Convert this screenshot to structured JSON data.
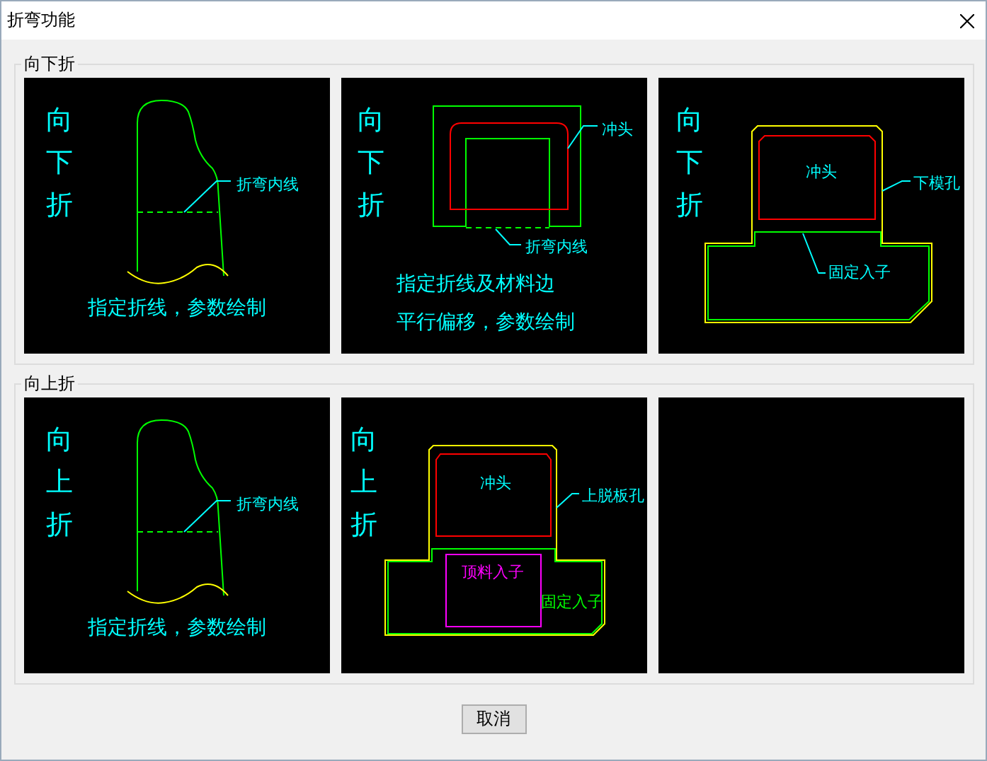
{
  "window": {
    "title": "折弯功能"
  },
  "groups": [
    {
      "title": "向下折",
      "panels": [
        {
          "kind": "profile",
          "side_label": "向下折",
          "labels": [
            {
              "text": "折弯内线",
              "color": "#00ffff"
            }
          ],
          "caption": [
            "指定折线，参数绘制"
          ]
        },
        {
          "kind": "punch",
          "side_label": "向下折",
          "labels": [
            {
              "text": "冲头",
              "color": "#00ffff"
            },
            {
              "text": "折弯内线",
              "color": "#00ffff"
            }
          ],
          "caption": [
            "指定折线及材料边",
            "平行偏移，参数绘制"
          ]
        },
        {
          "kind": "die",
          "side_label": "向下折",
          "labels": [
            {
              "text": "冲头",
              "color": "#00ffff"
            },
            {
              "text": "下模孔",
              "color": "#00ffff"
            },
            {
              "text": "固定入子",
              "color": "#00ffff"
            }
          ]
        }
      ]
    },
    {
      "title": "向上折",
      "panels": [
        {
          "kind": "profile",
          "side_label": "向上折",
          "labels": [
            {
              "text": "折弯内线",
              "color": "#00ffff"
            }
          ],
          "caption": [
            "指定折线，参数绘制"
          ]
        },
        {
          "kind": "die-ejector",
          "side_label": "向上折",
          "labels": [
            {
              "text": "冲头",
              "color": "#00ffff"
            },
            {
              "text": "上脱板孔",
              "color": "#00ffff"
            },
            {
              "text": "顶料入子",
              "color": "#ff00ff"
            },
            {
              "text": "固定入子",
              "color": "#00ff00"
            }
          ]
        },
        {
          "kind": "empty"
        }
      ]
    }
  ],
  "buttons": [
    "取消"
  ]
}
